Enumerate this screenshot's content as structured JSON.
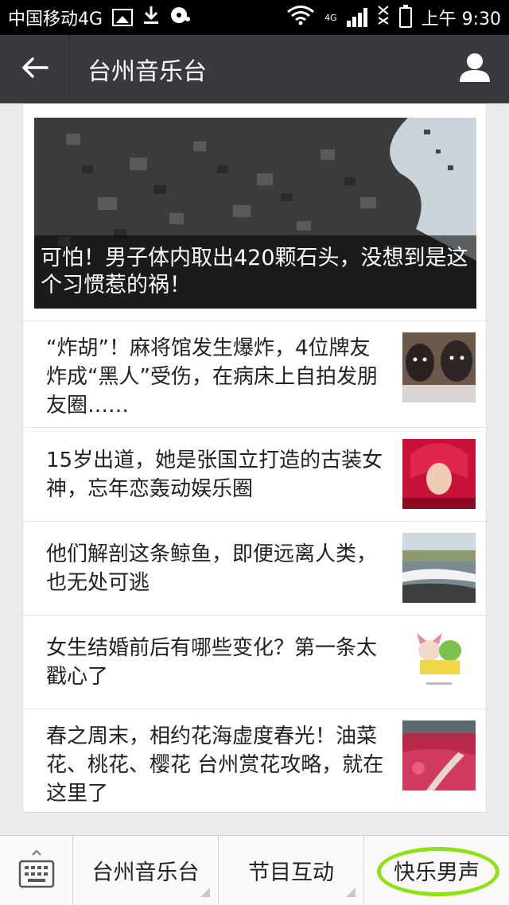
{
  "status_bar": {
    "carrier": "中国移动4G",
    "network": "4G",
    "time": "上午 9:30"
  },
  "header": {
    "title": "台州音乐台"
  },
  "hero": {
    "title": "可怕！男子体内取出420颗石头，没想到是这个习惯惹的祸！"
  },
  "news": [
    {
      "title": "“炸胡”！麻将馆发生爆炸，4位牌友炸成“黑人”受伤，在病床上自拍发朋友圈……"
    },
    {
      "title": "15岁出道，她是张国立打造的古装女神，忘年恋轰动娱乐圈"
    },
    {
      "title": "他们解剖这条鲸鱼，即便远离人类，也无处可逃"
    },
    {
      "title": "女生结婚前后有哪些变化？第一条太戳心了"
    },
    {
      "title": "春之周末，相约花海虚度春光！油菜花、桃花、樱花 台州赏花攻略，就在这里了"
    }
  ],
  "bottom_menu": {
    "items": [
      "台州音乐台",
      "节目互动",
      "快乐男声"
    ]
  },
  "colors": {
    "header_bg": "#393a3f",
    "highlight": "#8fe015"
  }
}
